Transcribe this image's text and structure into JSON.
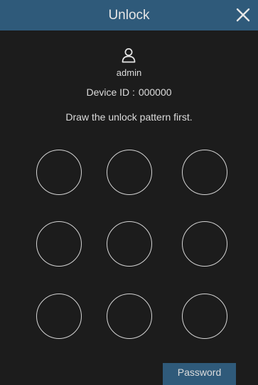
{
  "dialog": {
    "title": "Unlock",
    "close_icon": "close-icon"
  },
  "user": {
    "icon": "user-icon",
    "name": "admin"
  },
  "device": {
    "label": "Device ID :",
    "id": "000000"
  },
  "instruction": "Draw the unlock pattern first.",
  "pattern": {
    "rows": 3,
    "cols": 3,
    "nodes": [
      1,
      2,
      3,
      4,
      5,
      6,
      7,
      8,
      9
    ]
  },
  "password_button": {
    "label": "Password"
  },
  "colors": {
    "titlebar": "#2f5a7a",
    "background": "#1c1c1c",
    "text": "#dcdcdc",
    "circle": "#d4d4d4"
  }
}
